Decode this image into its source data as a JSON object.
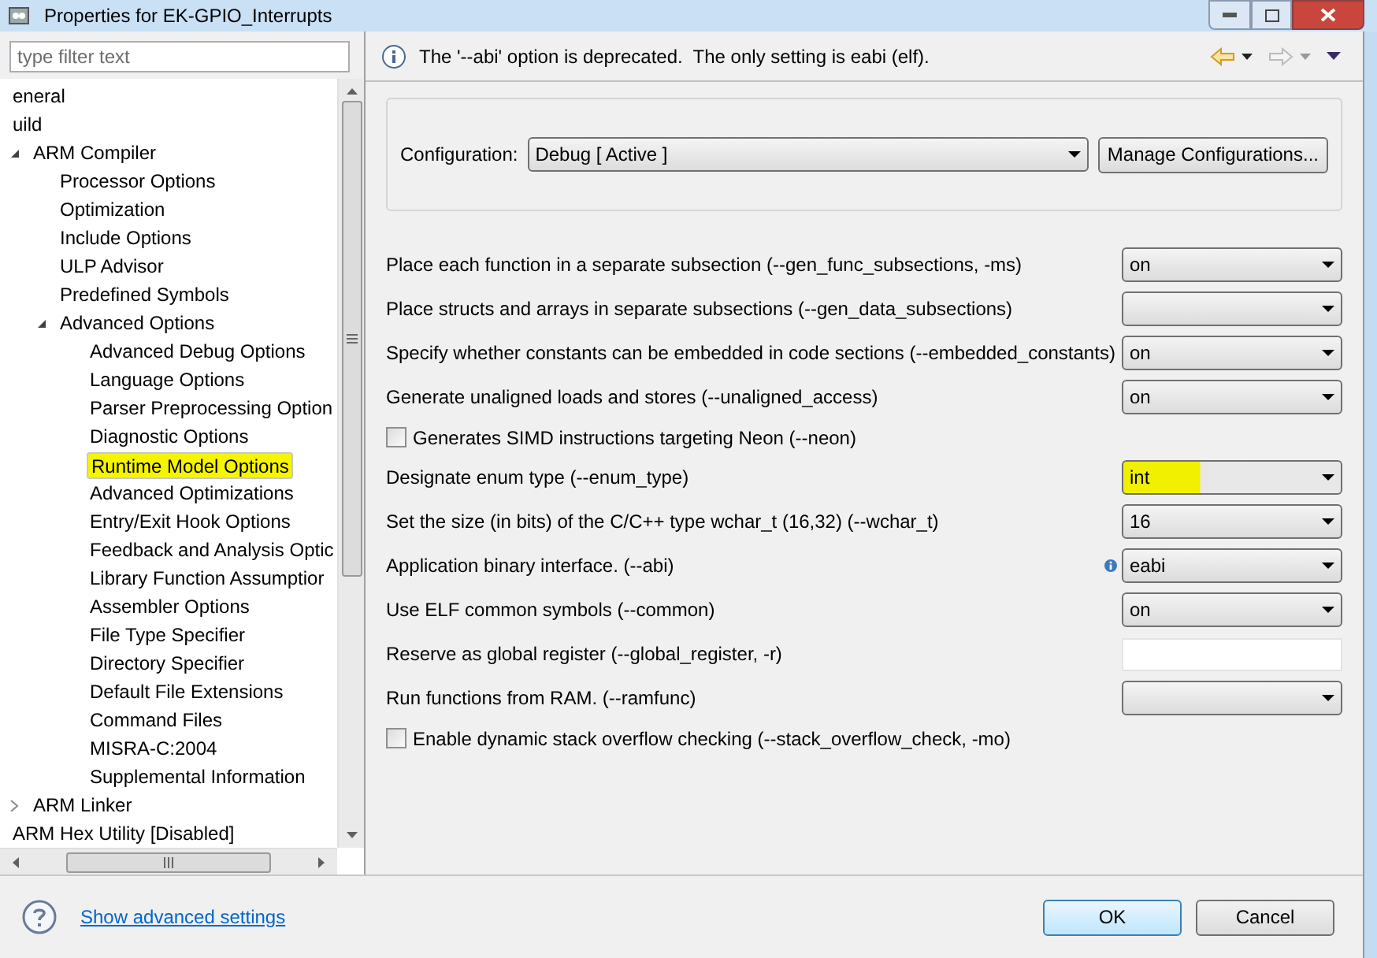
{
  "window": {
    "title": "Properties for EK-GPIO_Interrupts"
  },
  "filter": {
    "placeholder": "type filter text"
  },
  "tree": [
    {
      "label": "eneral",
      "selected": false,
      "highlighted": false
    },
    {
      "label": "uild",
      "selected": false,
      "highlighted": false
    },
    {
      "label": "ARM Compiler",
      "expanded": true,
      "selected": false,
      "highlighted": false,
      "children": [
        {
          "label": "Processor Options",
          "selected": false,
          "highlighted": false
        },
        {
          "label": "Optimization",
          "selected": false,
          "highlighted": false
        },
        {
          "label": "Include Options",
          "selected": false,
          "highlighted": false
        },
        {
          "label": "ULP Advisor",
          "selected": false,
          "highlighted": false
        },
        {
          "label": "Predefined Symbols",
          "selected": false,
          "highlighted": false
        },
        {
          "label": "Advanced Options",
          "expanded": true,
          "selected": false,
          "highlighted": false,
          "children": [
            {
              "label": "Advanced Debug Options",
              "selected": false,
              "highlighted": false
            },
            {
              "label": "Language Options",
              "selected": false,
              "highlighted": false
            },
            {
              "label": "Parser Preprocessing Option",
              "selected": false,
              "highlighted": false
            },
            {
              "label": "Diagnostic Options",
              "selected": false,
              "highlighted": false
            },
            {
              "label": "Runtime Model Options",
              "selected": true,
              "highlighted": true
            },
            {
              "label": "Advanced Optimizations",
              "selected": false,
              "highlighted": false
            },
            {
              "label": "Entry/Exit Hook Options",
              "selected": false,
              "highlighted": false
            },
            {
              "label": "Feedback and Analysis Optic",
              "selected": false,
              "highlighted": false
            },
            {
              "label": "Library Function Assumptior",
              "selected": false,
              "highlighted": false
            },
            {
              "label": "Assembler Options",
              "selected": false,
              "highlighted": false
            },
            {
              "label": "File Type Specifier",
              "selected": false,
              "highlighted": false
            },
            {
              "label": "Directory Specifier",
              "selected": false,
              "highlighted": false
            },
            {
              "label": "Default File Extensions",
              "selected": false,
              "highlighted": false
            },
            {
              "label": "Command Files",
              "selected": false,
              "highlighted": false
            },
            {
              "label": "MISRA-C:2004",
              "selected": false,
              "highlighted": false
            },
            {
              "label": "Supplemental Information",
              "selected": false,
              "highlighted": false
            }
          ]
        }
      ]
    },
    {
      "label": "ARM Linker",
      "expanded": false,
      "selected": false,
      "highlighted": false
    },
    {
      "label": "ARM Hex Utility  [Disabled]",
      "selected": false,
      "highlighted": false
    }
  ],
  "message": "The '--abi' option is deprecated.  The only setting is eabi (elf).",
  "configuration": {
    "label": "Configuration:",
    "value": "Debug  [ Active ]",
    "button": "Manage Configurations..."
  },
  "options": [
    {
      "kind": "select",
      "label": "Place each function in a separate subsection (--gen_func_subsections, -ms)",
      "value": "on",
      "highlighted": false
    },
    {
      "kind": "select",
      "label": "Place structs and arrays in separate subsections (--gen_data_subsections)",
      "highlighted": false
    },
    {
      "kind": "select",
      "label": "Specify whether constants can be embedded in code sections (--embedded_constants)",
      "value": "on",
      "highlighted": false
    },
    {
      "kind": "select",
      "label": "Generate unaligned loads and stores (--unaligned_access)",
      "value": "on",
      "highlighted": false
    },
    {
      "kind": "checkbox",
      "label": "Generates SIMD instructions targeting Neon (--neon)",
      "checked": false
    },
    {
      "kind": "select",
      "label": "Designate enum type (--enum_type)",
      "value": "int",
      "highlighted": true
    },
    {
      "kind": "select",
      "label": "Set the size (in bits) of the C/C++ type wchar_t (16,32) (--wchar_t)",
      "value": "16",
      "highlighted": false
    },
    {
      "kind": "select",
      "label": "Application binary interface. (--abi)",
      "value": "eabi",
      "info": true,
      "highlighted": false
    },
    {
      "kind": "select",
      "label": "Use ELF common symbols (--common)",
      "value": "on",
      "highlighted": false
    },
    {
      "kind": "text",
      "label": "Reserve as global register (--global_register, -r)"
    },
    {
      "kind": "select",
      "label": "Run functions from RAM. (--ramfunc)",
      "highlighted": false
    },
    {
      "kind": "checkbox",
      "label": "Enable dynamic stack overflow checking (--stack_overflow_check, -mo)",
      "checked": false
    }
  ],
  "footer": {
    "link": "Show advanced settings",
    "buttons": [
      {
        "label": "OK",
        "default": true
      },
      {
        "label": "Cancel",
        "default": false
      }
    ]
  }
}
